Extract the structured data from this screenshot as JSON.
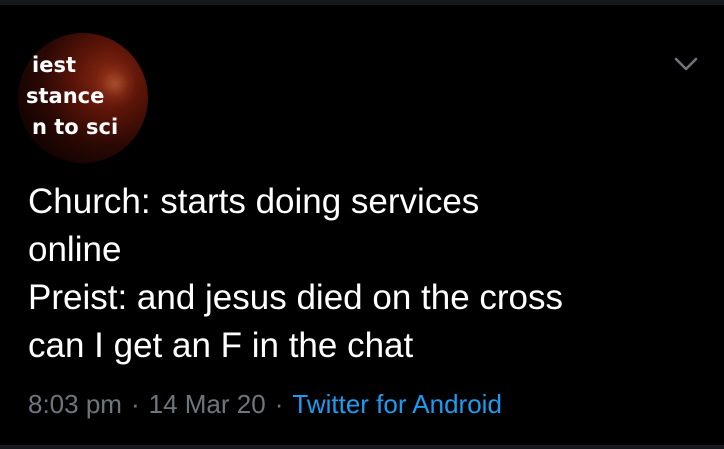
{
  "avatar": {
    "lines": [
      "iest",
      "stance",
      "n to sci"
    ]
  },
  "tweet": {
    "lines": [
      "Church: starts doing services",
      "online",
      "Preist: and jesus died on the cross",
      "can I get an F in the chat"
    ],
    "time": "8:03 pm",
    "date": "14 Mar 20",
    "separator": "·",
    "source": "Twitter for Android"
  },
  "menu": {
    "icon": "chevron-down-icon"
  },
  "colors": {
    "background": "#000000",
    "text": "#ffffff",
    "meta": "#6e767d",
    "link": "#1d9bf0"
  }
}
